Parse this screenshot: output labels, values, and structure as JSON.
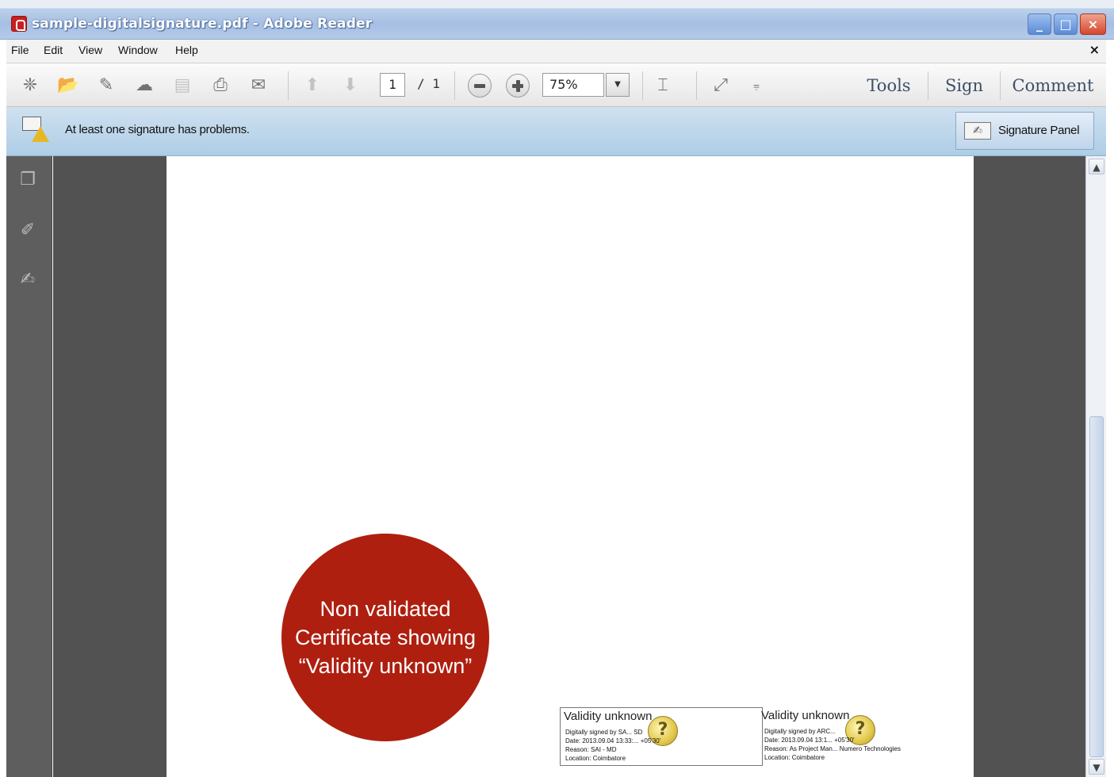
{
  "window": {
    "title": "sample-digitalsignature.pdf - Adobe Reader",
    "controls": {
      "minimize": "_",
      "maximize": "□",
      "close": "×"
    }
  },
  "menu": {
    "items": [
      "File",
      "Edit",
      "View",
      "Window",
      "Help"
    ],
    "close_doc": "×"
  },
  "toolbar": {
    "icons": [
      "create-icon",
      "open-icon",
      "edit-icon",
      "upload-icon",
      "save-icon",
      "print-icon",
      "email-icon",
      "prev-page-icon",
      "next-page-icon",
      "zoom-out-icon",
      "zoom-in-icon",
      "fit-page-icon",
      "fullscreen-icon",
      "more-icon"
    ],
    "page_current": "1",
    "page_total": "/ 1",
    "zoom": "75%",
    "tabs": [
      "Tools",
      "Sign",
      "Comment"
    ]
  },
  "signature_bar": {
    "message": "At least one signature has problems.",
    "panel_button": "Signature Panel"
  },
  "callout": {
    "text": "Non validated Certificate showing “Validity unknown”",
    "color": "#ae1f10"
  },
  "signatures": [
    {
      "status": "Validity unknown",
      "lines": [
        "Digitally signed by SA... SD",
        "Date: 2013.09.04 13:33:... +05'30'",
        "Reason: SAI - MD",
        "Location: Coimbatore"
      ]
    },
    {
      "status": "Validity unknown",
      "lines": [
        "Digitally signed by ARC...",
        "Date: 2013.09.04 13:1... +05'30'",
        "Reason: As Project Man... Numero Technologies",
        "Location: Coimbatore"
      ]
    }
  ]
}
